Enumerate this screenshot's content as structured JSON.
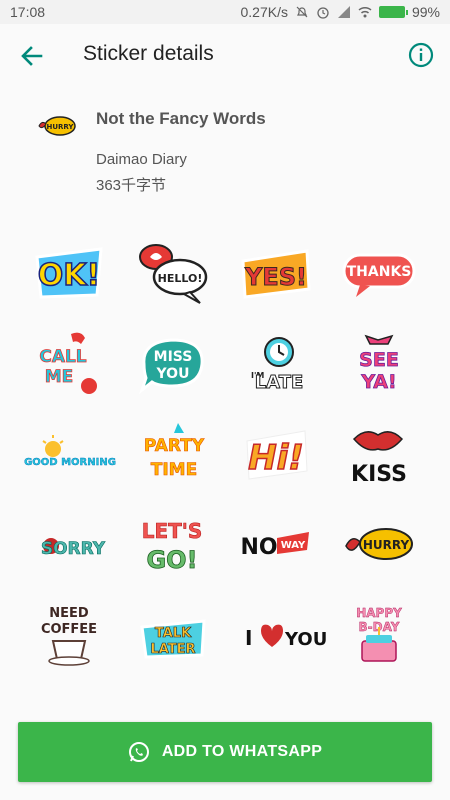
{
  "status_bar": {
    "time": "17:08",
    "network_speed": "0.27K/s",
    "battery": "99%"
  },
  "app_bar": {
    "title": "Sticker details",
    "back_icon": "arrow-back-icon",
    "info_icon": "info-icon"
  },
  "pack": {
    "name": "Not the Fancy Words",
    "publisher": "Daimao Diary",
    "size": "363千字节"
  },
  "stickers": [
    {
      "name": "ok",
      "text": "OK!"
    },
    {
      "name": "hello",
      "text": "HELLO!"
    },
    {
      "name": "yes",
      "text": "YES!"
    },
    {
      "name": "thanks",
      "text": "THANKS"
    },
    {
      "name": "call-me",
      "text": "CALL ME"
    },
    {
      "name": "miss-you",
      "text": "MISS YOU"
    },
    {
      "name": "im-late",
      "text": "I'M LATE"
    },
    {
      "name": "see-ya",
      "text": "SEE YA!"
    },
    {
      "name": "good-morning",
      "text": "GOOD MORNING"
    },
    {
      "name": "party-time",
      "text": "PARTY TIME"
    },
    {
      "name": "hi",
      "text": "Hi!"
    },
    {
      "name": "kiss",
      "text": "KISS"
    },
    {
      "name": "sorry",
      "text": "SORRY"
    },
    {
      "name": "lets-go",
      "text": "LET'S GO!"
    },
    {
      "name": "no-way",
      "text": "NO WAY"
    },
    {
      "name": "hurry",
      "text": "HURRY"
    },
    {
      "name": "need-coffee",
      "text": "NEED COFFEE"
    },
    {
      "name": "talk-later",
      "text": "TALK LATER"
    },
    {
      "name": "i-love-you",
      "text": "I ♥ YOU"
    },
    {
      "name": "happy-bday",
      "text": "HAPPY B-DAY"
    }
  ],
  "add_button": {
    "label": "ADD TO WHATSAPP",
    "icon": "whatsapp-icon"
  },
  "colors": {
    "accent": "#3bb54a",
    "icon_teal": "#00897b"
  }
}
